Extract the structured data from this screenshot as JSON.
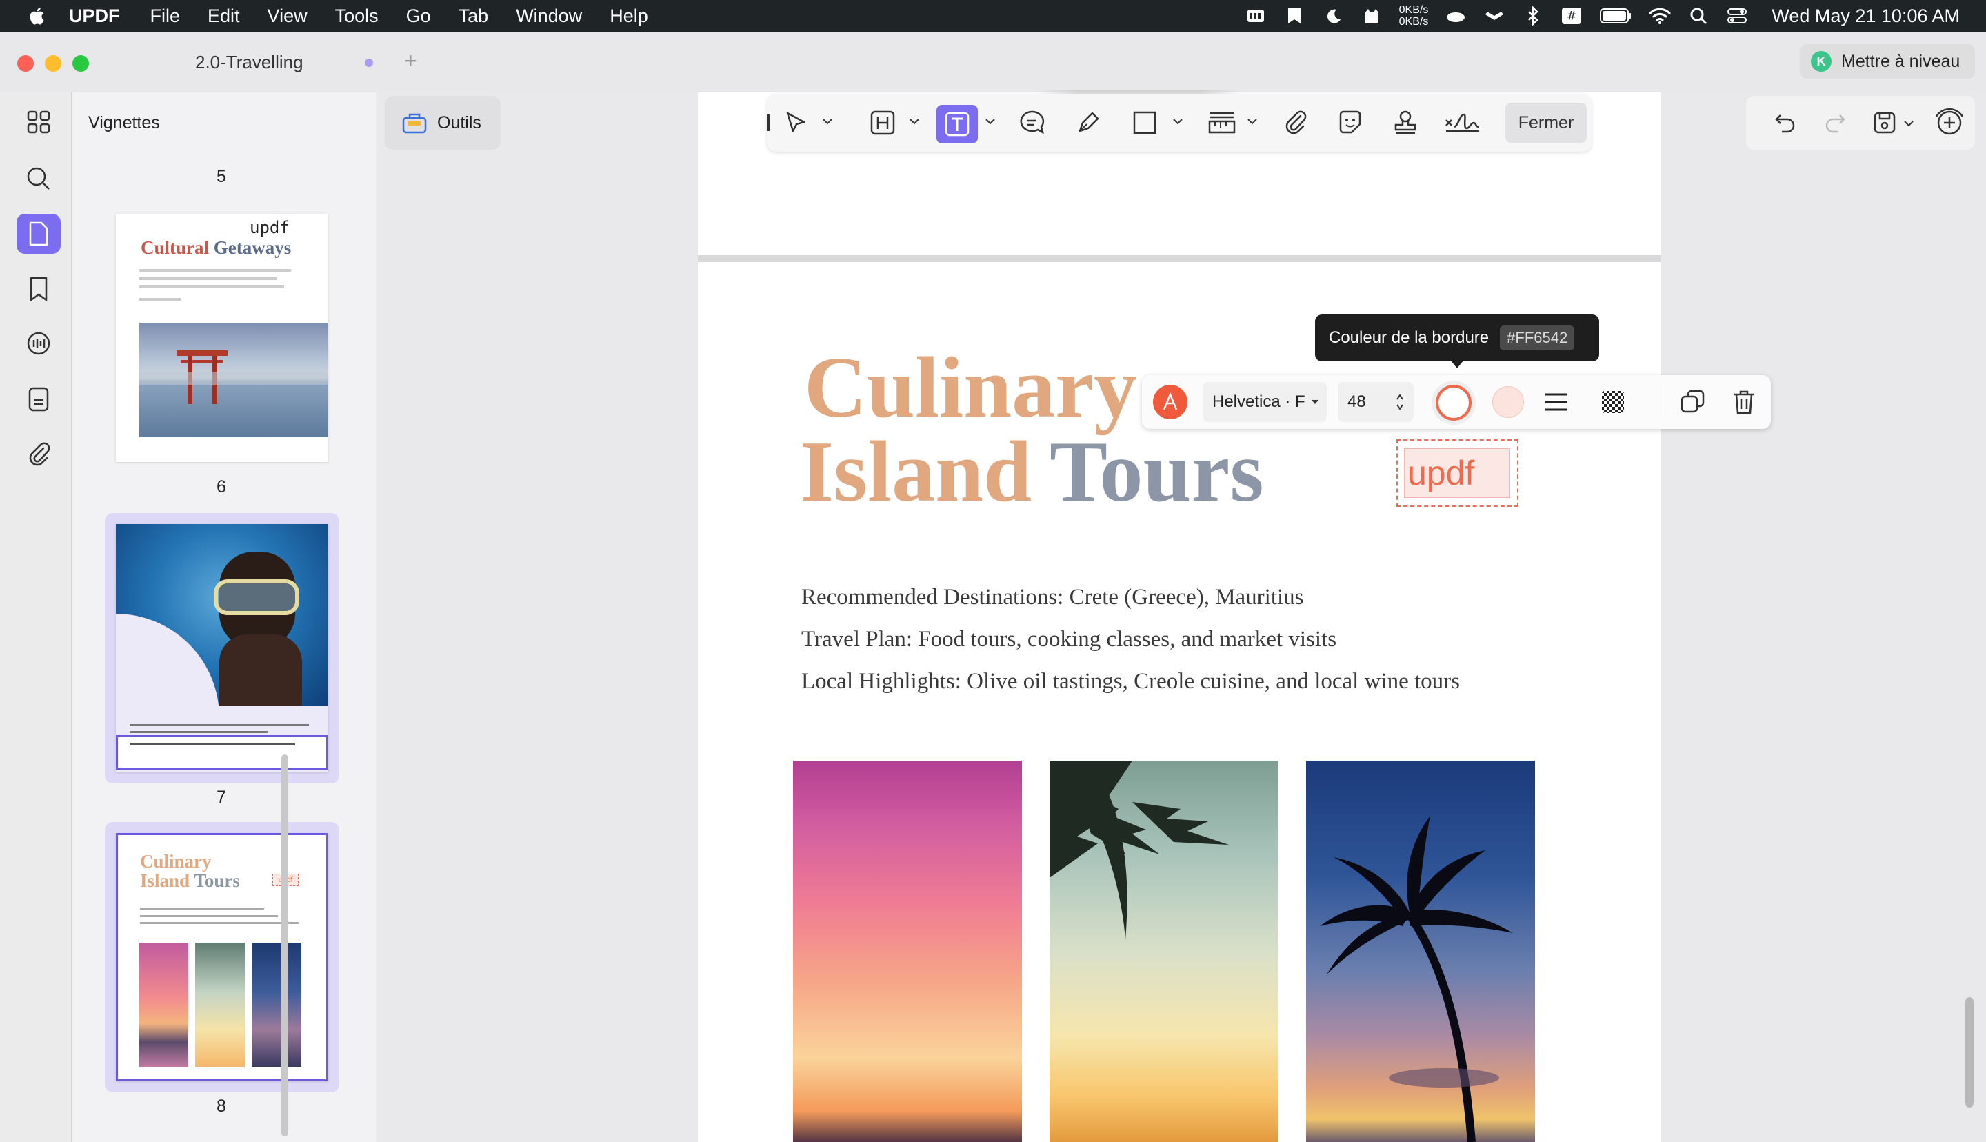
{
  "menubar": {
    "app_name": "UPDF",
    "items": [
      "File",
      "Edit",
      "View",
      "Tools",
      "Go",
      "Tab",
      "Window",
      "Help"
    ],
    "net_up": "0KB/s",
    "net_down": "0KB/s",
    "clock": "Wed May 21  10:06 AM"
  },
  "window": {
    "tab_title": "2.0-Travelling",
    "upgrade_badge": "K",
    "upgrade_label": "Mettre à niveau"
  },
  "thumbnails": {
    "title": "Vignettes",
    "page_numbers": [
      "5",
      "6",
      "7",
      "8"
    ],
    "page6": {
      "title_a": "Cultural",
      "title_b": "Getaways",
      "stamp": "updf"
    },
    "page8": {
      "title_a": "Culinary",
      "title_b": "Island",
      "title_c": "Tours",
      "stamp": "updf"
    }
  },
  "toolbar": {
    "outils_label": "Outils",
    "fermer_label": "Fermer"
  },
  "page": {
    "heading_line1": "Culinary",
    "heading_line2a": "Island",
    "heading_line2b": "Tours",
    "lines": [
      "Recommended Destinations: Crete (Greece), Mauritius",
      "Travel Plan: Food tours, cooking classes, and market visits",
      "Local Highlights: Olive oil tastings, Creole cuisine, and local wine tours"
    ],
    "textbox_text": "updf"
  },
  "tooltip": {
    "label": "Couleur de la bordure",
    "hex": "#FF6542"
  },
  "formatbar": {
    "font_label": "Helvetica · F",
    "size_value": "48"
  },
  "colors": {
    "accent": "#7c6cf0",
    "heading_orange": "#e1a77f",
    "heading_grey": "#8d96a6",
    "border_color": "#FF6542"
  }
}
